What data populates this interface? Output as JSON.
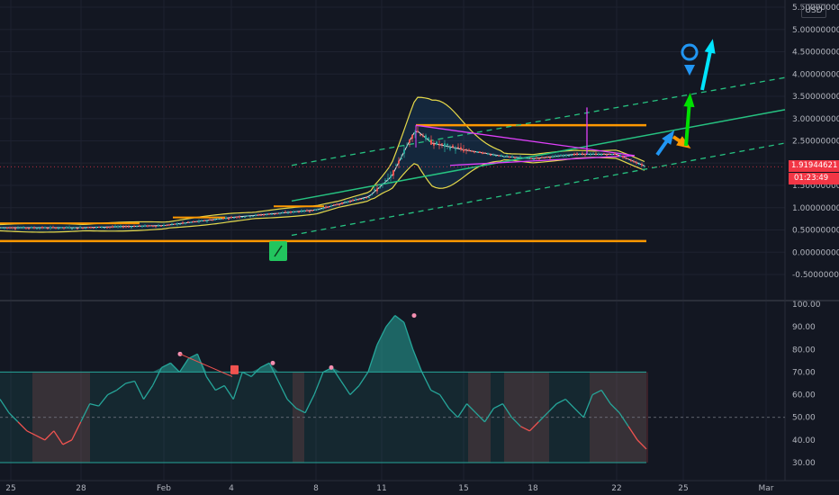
{
  "currency": "USD",
  "price_label": "1.91944621",
  "countdown": "01:23:49",
  "colors": {
    "background": "#131722",
    "grid": "#1e2230",
    "bull": "#26a69a",
    "bear": "#ef5350",
    "orange": "#ff9800",
    "bollinger": "#e6d94a",
    "channel": "#26c281",
    "magenta": "#e040fb",
    "rsi_line": "#26a69a",
    "rsi_low": "#ef5350"
  },
  "chart_data": [
    {
      "type": "candlestick",
      "title": "",
      "y_ticks": [
        "5.50000000",
        "5.00000000",
        "4.50000000",
        "4.00000000",
        "3.50000000",
        "3.00000000",
        "2.50000000",
        "2.00000000",
        "1.50000000",
        "1.00000000",
        "0.50000000",
        "0.00000000",
        "-0.50000000"
      ],
      "x_ticks": [
        "25",
        "28",
        "Feb",
        "4",
        "8",
        "11",
        "15",
        "18",
        "22",
        "25",
        "Mar"
      ],
      "ylim": [
        -0.6,
        5.7
      ],
      "support_levels": [
        0.25,
        0.65,
        2.85
      ],
      "last_price": 1.91944621,
      "series_close_approx": [
        {
          "x": "Jan 25",
          "y": 0.55
        },
        {
          "x": "Jan 28",
          "y": 0.55
        },
        {
          "x": "Feb 1",
          "y": 0.6
        },
        {
          "x": "Feb 4",
          "y": 0.78
        },
        {
          "x": "Feb 8",
          "y": 0.95
        },
        {
          "x": "Feb 10",
          "y": 1.3
        },
        {
          "x": "Feb 11",
          "y": 2.2
        },
        {
          "x": "Feb 12",
          "y": 2.6
        },
        {
          "x": "Feb 15",
          "y": 2.3
        },
        {
          "x": "Feb 18",
          "y": 2.1
        },
        {
          "x": "Feb 21",
          "y": 2.2
        },
        {
          "x": "Feb 23",
          "y": 1.92
        }
      ]
    },
    {
      "type": "line",
      "title": "",
      "y_ticks": [
        "100.00",
        "90.00",
        "80.00",
        "70.00",
        "60.00",
        "50.00",
        "40.00",
        "30.00"
      ],
      "ylim": [
        28,
        102
      ],
      "overbought": 70,
      "midline": 50,
      "oversold": 30,
      "values": [
        58,
        52,
        48,
        44,
        42,
        40,
        44,
        38,
        40,
        48,
        56,
        55,
        60,
        62,
        65,
        66,
        58,
        64,
        72,
        74,
        70,
        76,
        78,
        68,
        62,
        64,
        58,
        70,
        68,
        72,
        74,
        66,
        58,
        54,
        52,
        60,
        70,
        72,
        66,
        60,
        64,
        70,
        82,
        90,
        95,
        92,
        80,
        70,
        62,
        60,
        54,
        50,
        56,
        52,
        48,
        54,
        56,
        50,
        46,
        44,
        48,
        52,
        56,
        58,
        54,
        50,
        60,
        62,
        56,
        52,
        46,
        40,
        36
      ]
    }
  ]
}
